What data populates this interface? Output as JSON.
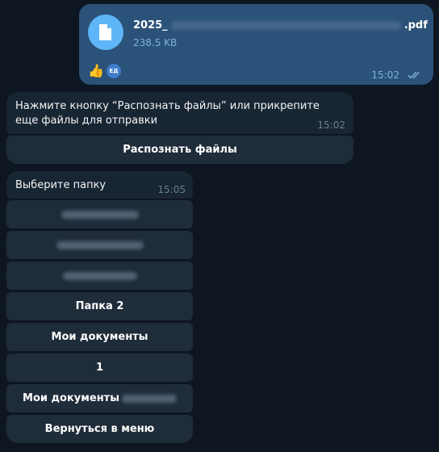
{
  "file_message": {
    "name_prefix": "2025_",
    "name_suffix": ".pdf",
    "size": "238.5 KB",
    "icon": "file-icon",
    "reactions": {
      "emoji": "👍",
      "avatar_initials": "ЕД"
    },
    "time": "15:02",
    "status_icon": "double-check-icon",
    "colors": {
      "bubble": "#2b5278",
      "icon_bg": "#5eb5f7",
      "meta": "#7fb1dc"
    }
  },
  "message_recognize": {
    "text": "Нажмите кнопку “Распознать файлы” или прикрепите еще файлы для отправки",
    "time": "15:02",
    "buttons": [
      {
        "label": "Распознать файлы"
      }
    ]
  },
  "message_folder": {
    "text": "Выберите папку",
    "time": "15:05",
    "buttons": [
      {
        "label": ""
      },
      {
        "label": ""
      },
      {
        "label": ""
      },
      {
        "label": "Папка 2"
      },
      {
        "label": "Мои документы"
      },
      {
        "label": "1"
      },
      {
        "label": "Мои документы"
      },
      {
        "label": "Вернуться в меню"
      }
    ]
  },
  "theme": {
    "background": "#0e1621",
    "incoming_bubble": "#182533",
    "keyboard_button": "#1f2c3a",
    "muted_text": "#6d7f8f"
  }
}
